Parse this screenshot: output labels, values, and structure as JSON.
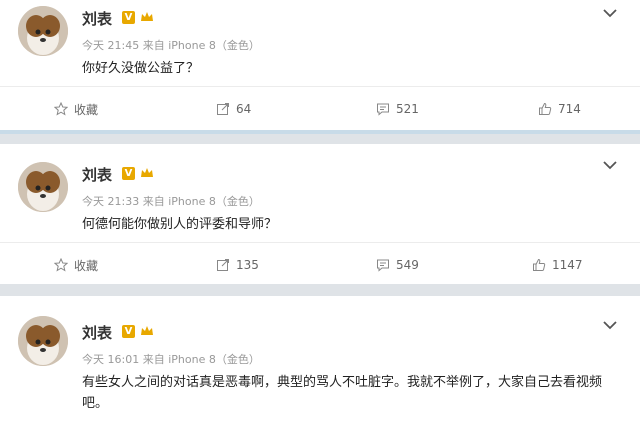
{
  "posts": [
    {
      "author": "刘表",
      "time": "今天 21:45",
      "source_prefix": "来自",
      "source": "iPhone 8（金色）",
      "text": "你好久没做公益了？",
      "actions": {
        "collect": "收藏",
        "repost": "64",
        "comment": "521",
        "like": "714"
      }
    },
    {
      "author": "刘表",
      "time": "今天 21:33",
      "source_prefix": "来自",
      "source": "iPhone 8（金色）",
      "text": "何德何能你做别人的评委和导师？",
      "actions": {
        "collect": "收藏",
        "repost": "135",
        "comment": "549",
        "like": "1147"
      }
    },
    {
      "author": "刘表",
      "time": "今天 16:01",
      "source_prefix": "来自",
      "source": "iPhone 8（金色）",
      "text": "有些女人之间的对话真是恶毒啊，典型的骂人不吐脏字。我就不举例了，大家自己去看视频吧。"
    }
  ],
  "colors": {
    "badge": "#e8a800",
    "background": "#dfe3e7"
  },
  "icons": [
    "star-icon",
    "repost-icon",
    "comment-icon",
    "like-icon",
    "chevron-down-icon",
    "verified-v-icon",
    "crown-icon"
  ]
}
